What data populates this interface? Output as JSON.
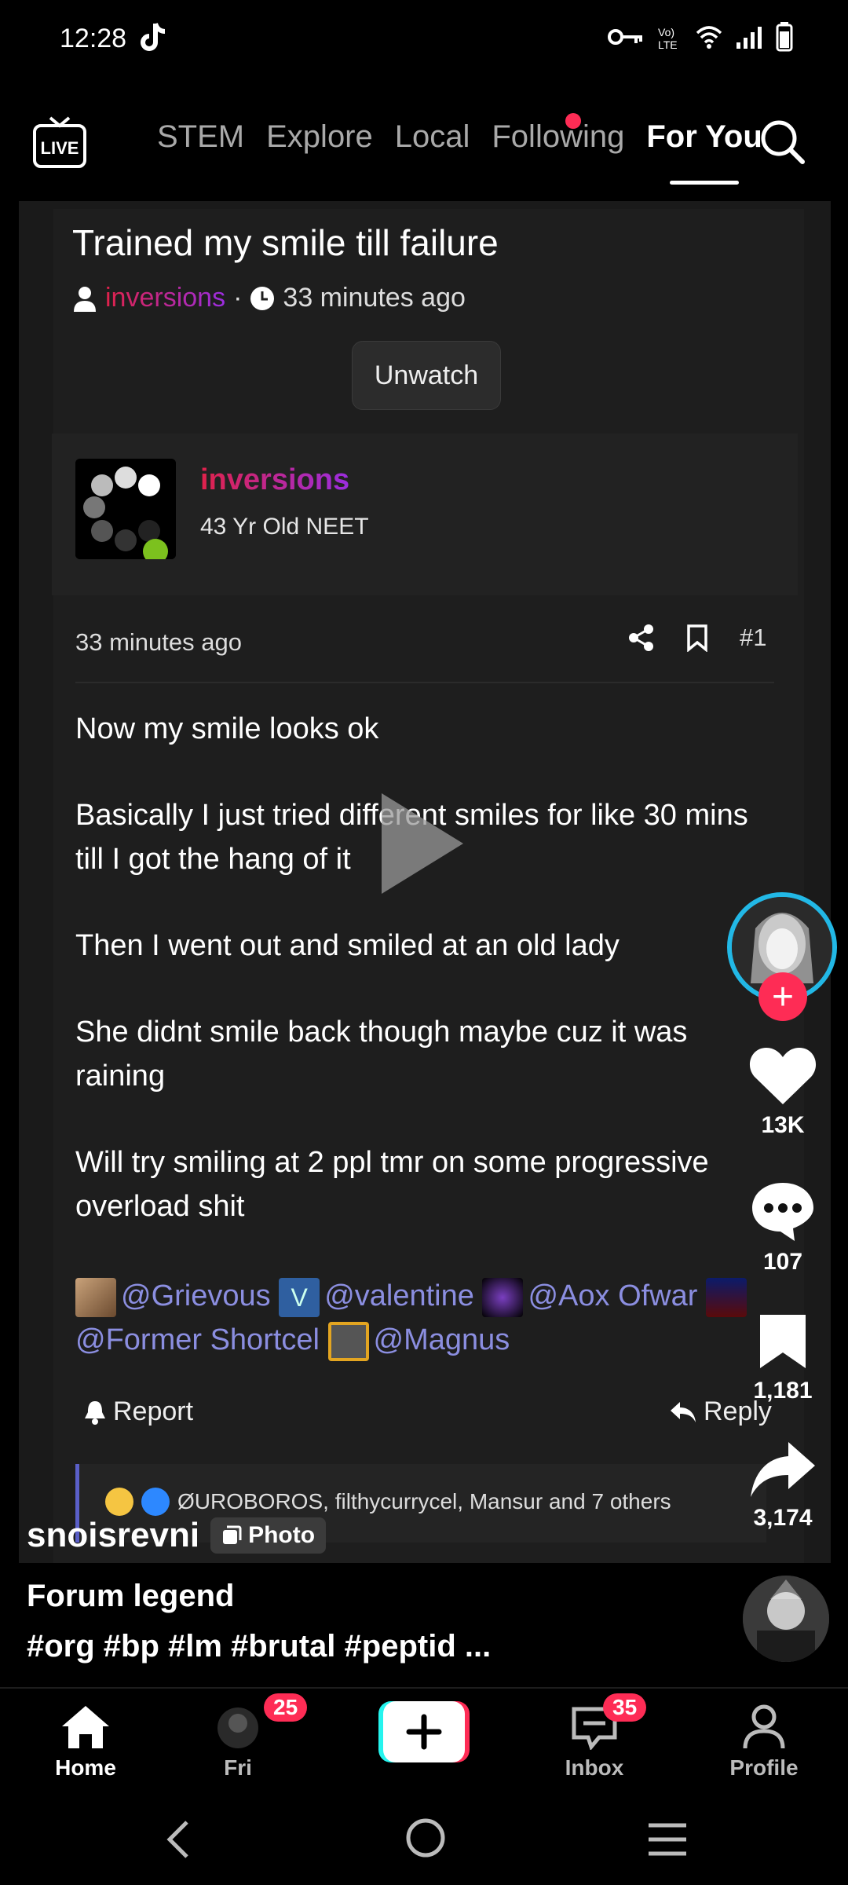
{
  "status": {
    "time": "12:28"
  },
  "top_nav": {
    "tabs": [
      "STEM",
      "Explore",
      "Local",
      "Following",
      "For You"
    ],
    "active_tab": "For You"
  },
  "post": {
    "title": "Trained my smile till failure",
    "author": "inversions",
    "time_ago": "33 minutes ago",
    "unwatch_label": "Unwatch",
    "user_title": "43 Yr Old NEET",
    "post_number": "#1",
    "paragraphs": [
      "Now my smile looks ok",
      "Basically I just tried different smiles for like 30 mins till I got the hang of it",
      "Then I went out and smiled at an old lady",
      "She didnt smile back though maybe cuz it was raining",
      "Will try smiling at 2 ppl tmr on some progressive overload shit"
    ],
    "mentions": [
      "@Grievous",
      "@valentine",
      "@Aox Ofwar",
      "@Former Shortcel",
      "@Magnus"
    ],
    "report_label": "Report",
    "reply_label": "Reply",
    "reactions_text": "ØUROBOROS, filthycurrycel, Mansur and 7 others"
  },
  "rail": {
    "likes": "13K",
    "comments": "107",
    "saves": "1,181",
    "shares": "3,174"
  },
  "caption": {
    "username": "snoisrevni",
    "photo_label": "Photo",
    "tagline": "Forum legend",
    "hashtags": "#org #bp #lm #brutal #peptid ..."
  },
  "bottom_nav": {
    "home": "Home",
    "friends": "Fri",
    "friends_badge": "25",
    "inbox": "Inbox",
    "inbox_badge": "35",
    "profile": "Profile"
  },
  "colors": {
    "accent": "#fe2c55",
    "ring": "#22b8e6",
    "mention": "#8b8ee0"
  }
}
